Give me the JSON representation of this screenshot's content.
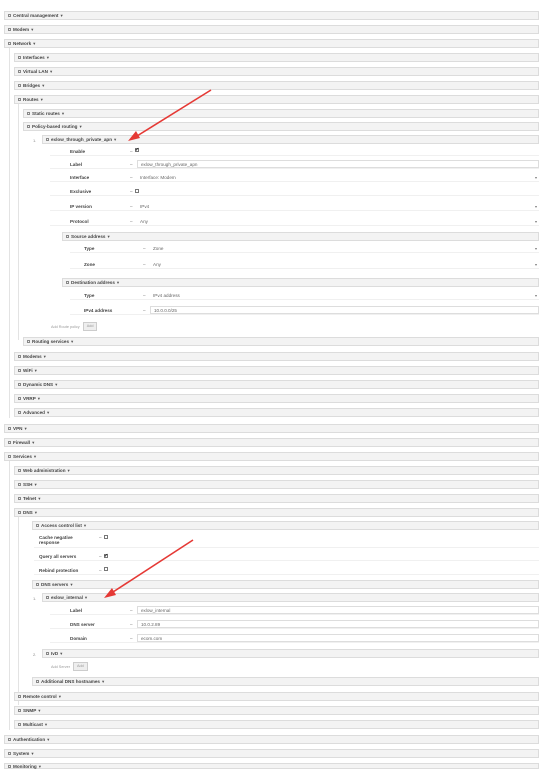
{
  "tree": {
    "central_management": "Central management",
    "modem": "Modem",
    "network": "Network",
    "interfaces": "Interfaces",
    "virtual_lan": "Virtual LAN",
    "bridges": "Bridges",
    "routes": "Routes",
    "static_routes": "Static routes",
    "policy_based_routing": "Policy-based routing",
    "policy_item": {
      "index": "1.",
      "name": "exlow_through_private_apn",
      "enable_label": "Enable",
      "label_label": "Label",
      "label_value": "exlow_through_private_apn",
      "interface_label": "Interface",
      "interface_value": "Interface: Modem",
      "exclusive_label": "Exclusive",
      "ip_version_label": "IP version",
      "ip_version_value": "IPv4",
      "protocol_label": "Protocol",
      "protocol_value": "Any",
      "source_address": "Source address",
      "src_type_label": "Type",
      "src_type_value": "Zone",
      "src_zone_label": "Zone",
      "src_zone_value": "Any",
      "destination_address": "Destination address",
      "dst_type_label": "Type",
      "dst_type_value": "IPv4 address",
      "dst_ipv4_label": "IPv4 address",
      "dst_ipv4_value": "10.0.0.0/25"
    },
    "add_route_policy": "Add Route policy",
    "add": "Add",
    "routing_services": "Routing services",
    "modems": "Modems",
    "wifi": "WiFi",
    "dynamic_dns": "Dynamic DNS",
    "vrrp": "VRRP",
    "advanced": "Advanced",
    "vpn": "VPN",
    "firewall": "Firewall",
    "services": "Services",
    "web_administration": "Web administration",
    "ssh": "SSH",
    "telnet": "Telnet",
    "dns": "DNS",
    "access_control_list": "Access control list",
    "cache_negative_line1": "Cache negative",
    "cache_negative_line2": "response",
    "query_all_servers": "Query all servers",
    "rebind_protection": "Rebind protection",
    "dns_servers": "DNS servers",
    "dns_item1": {
      "index": "1.",
      "name": "exlow_internal",
      "label_label": "Label",
      "label_value": "exlow_internal",
      "dns_server_label": "DNS server",
      "dns_server_value": "10.0.2.89",
      "domain_label": "Domain",
      "domain_value": "ecom.com"
    },
    "dns_item2": {
      "index": "2.",
      "name": "IvD"
    },
    "add_server": "Add Server",
    "additional_dns_hostnames": "Additional DNS hostnames",
    "remote_control": "Remote control",
    "snmp": "SNMP",
    "multicast": "Multicast",
    "authentication": "Authentication",
    "system": "System",
    "monitoring": "Monitoring"
  },
  "caret": "▾",
  "check": "✔",
  "dash": "–",
  "select_arrow": "▾",
  "colors": {
    "annotation_arrow": "#e53935"
  }
}
